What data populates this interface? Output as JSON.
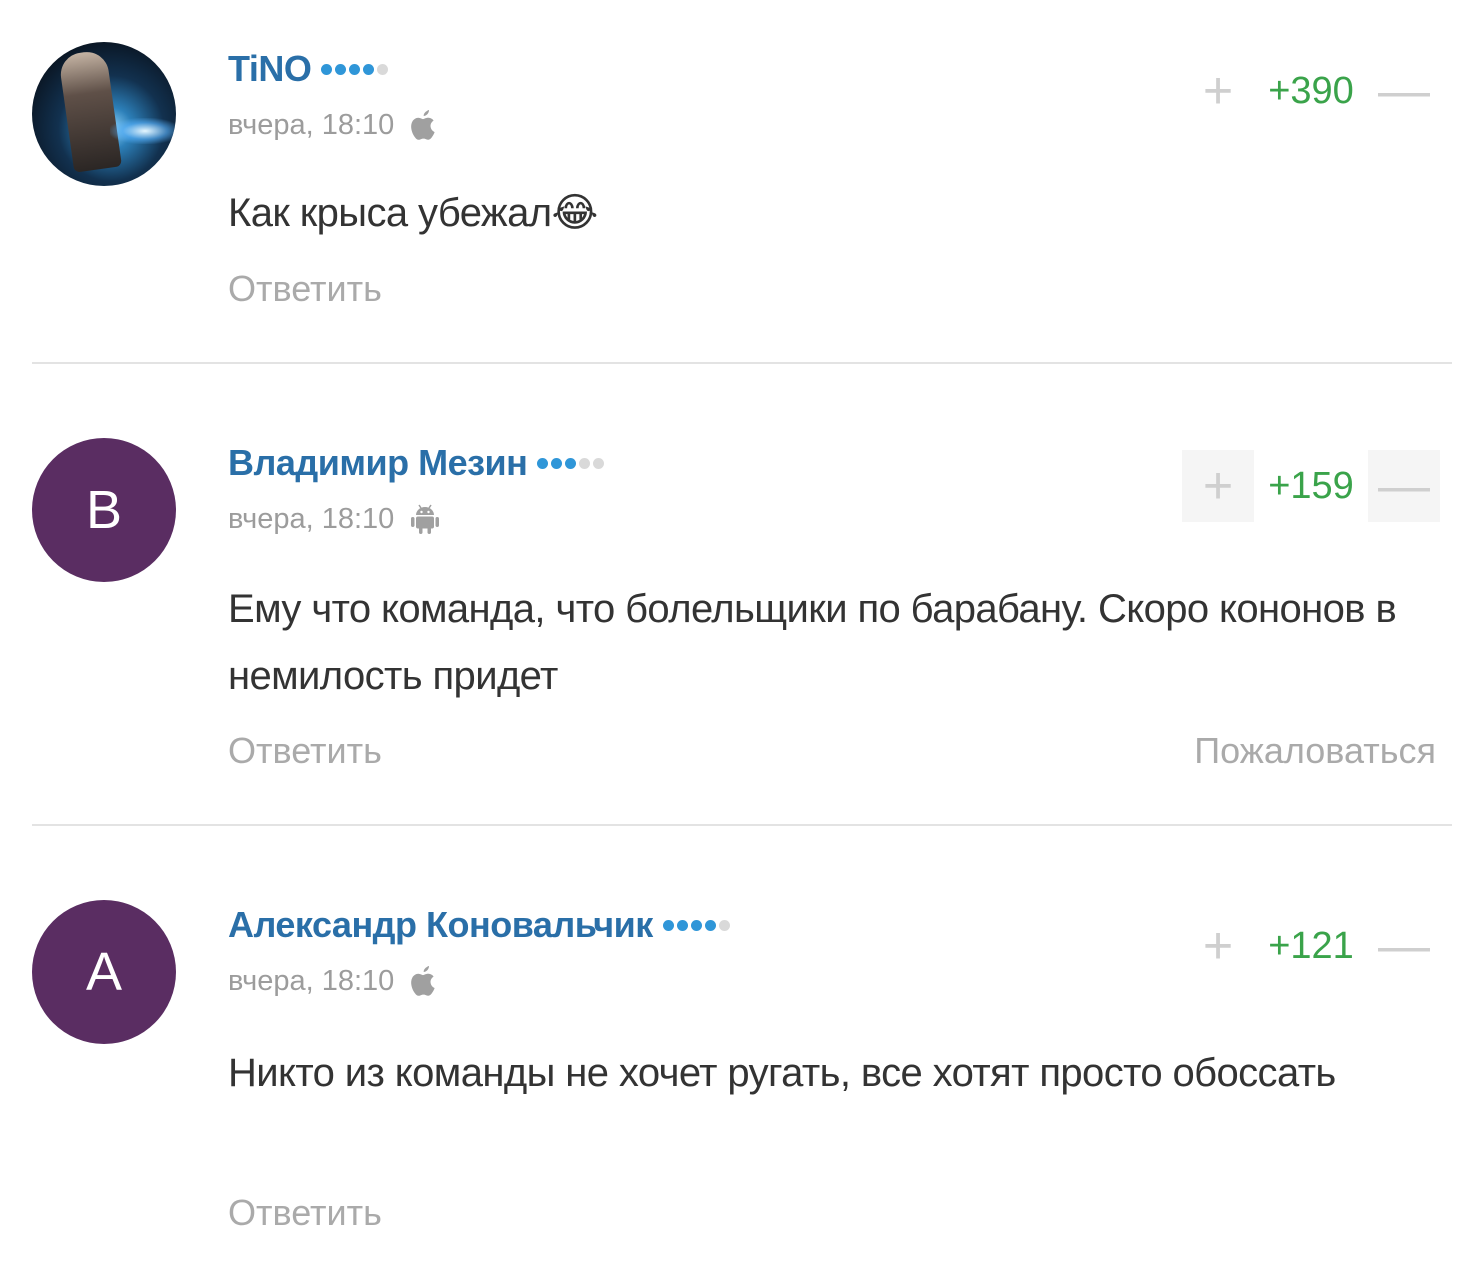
{
  "comments": [
    {
      "author": "TiNO",
      "level_dots": [
        true,
        true,
        true,
        true,
        false
      ],
      "time": "вчера, 18:10",
      "device": "apple-icon",
      "text": "Как крыса убежал😂",
      "score": "+390",
      "reply_label": "Ответить",
      "avatar": {
        "type": "photo"
      }
    },
    {
      "author": "Владимир Мезин",
      "level_dots": [
        true,
        true,
        true,
        false,
        false
      ],
      "time": "вчера, 18:10",
      "device": "android-icon",
      "text": "Ему что команда, что болельщики по барабану. Скоро кононов в немилость придет",
      "score": "+159",
      "reply_label": "Ответить",
      "report_label": "Пожаловаться",
      "avatar": {
        "type": "letter",
        "letter": "В",
        "color": "#5a2d62"
      }
    },
    {
      "author": "Александр Коновальчик",
      "level_dots": [
        true,
        true,
        true,
        true,
        false
      ],
      "time": "вчера, 18:10",
      "device": "apple-icon",
      "text": "Никто из команды не хочет ругать, все хотят просто обоссать",
      "score": "+121",
      "reply_label": "Ответить",
      "avatar": {
        "type": "letter",
        "letter": "А",
        "color": "#5a2d62"
      }
    }
  ],
  "vote": {
    "plus": "+",
    "minus": "—"
  }
}
